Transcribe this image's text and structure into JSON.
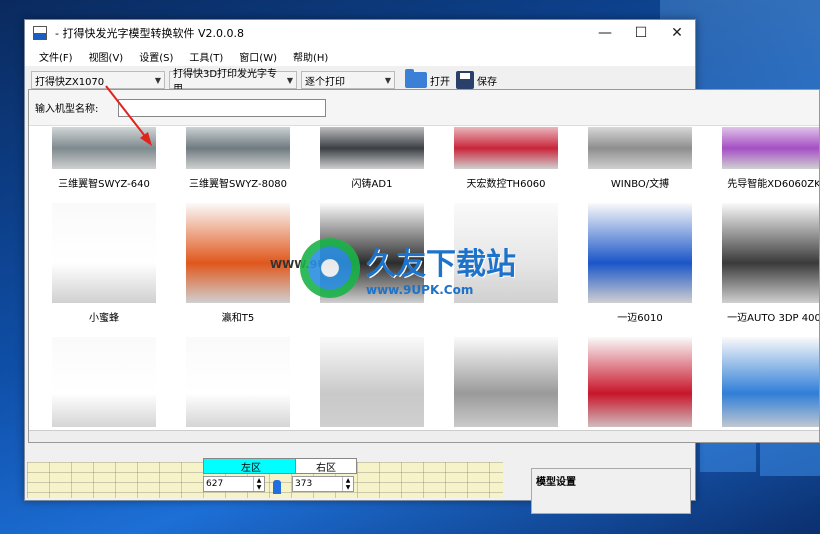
{
  "window": {
    "title": "- 打得快发光字模型转换软件 V2.0.0.8",
    "minimize": "—",
    "maximize": "☐",
    "close": "✕"
  },
  "menu": [
    "文件(F)",
    "视图(V)",
    "设置(S)",
    "工具(T)",
    "窗口(W)",
    "帮助(H)"
  ],
  "toolbar": {
    "machine_combo": "打得快ZX1070",
    "material_combo": "打得快3D打印发光字专用",
    "mode_combo": "逐个打印",
    "open_label": "打开",
    "save_label": "保存"
  },
  "dialog": {
    "search_label": "输入机型名称:",
    "search_value": ""
  },
  "gallery": [
    {
      "name": "三维翼智SWYZ-640",
      "theme": "#7d8a8e"
    },
    {
      "name": "三维翼智SWYZ-8080",
      "theme": "#6e7b80"
    },
    {
      "name": "闪铸AD1",
      "theme": "#3b3f44"
    },
    {
      "name": "天宏数控TH6060",
      "theme": "#c8263a"
    },
    {
      "name": "WINBO/文搏",
      "theme": "#8e8e8e"
    },
    {
      "name": "先导智能XD6060ZK",
      "theme": "#a54fc4"
    },
    {
      "name": "小蜜蜂",
      "theme": "#ffffff"
    },
    {
      "name": "瀛和T5",
      "theme": "#e0571c"
    },
    {
      "name": "",
      "theme": "#2c2c2c"
    },
    {
      "name": "",
      "theme": "#e6e6e6"
    },
    {
      "name": "一迈6010",
      "theme": "#1a55c8"
    },
    {
      "name": "一迈AUTO 3DP 400",
      "theme": "#3a3a3a"
    },
    {
      "name": "",
      "theme": "#ffffff"
    },
    {
      "name": "",
      "theme": "#ffffff"
    },
    {
      "name": "",
      "theme": "#c9c9c9"
    },
    {
      "name": "",
      "theme": "#9a9a9a"
    },
    {
      "name": "",
      "theme": "#c8152a"
    },
    {
      "name": "",
      "theme": "#2f7ed8"
    }
  ],
  "bottom": {
    "left_zone": "左区",
    "right_zone": "右区",
    "left_value": "627",
    "right_value": "373",
    "model_settings": "模型设置"
  },
  "watermark": {
    "cn": "久友下载站",
    "url": "www.9UPK.Com",
    "left_text": "WWW.9U"
  },
  "colors": {
    "accent_cyan": "#00ffff",
    "arrow_red": "#e0241c"
  }
}
